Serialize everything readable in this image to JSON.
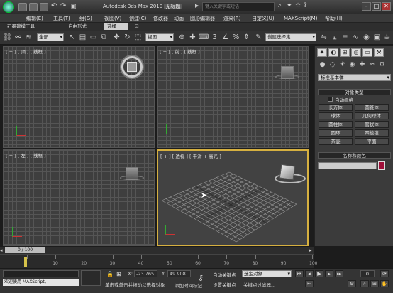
{
  "titlebar": {
    "app_title": "Autodesk 3ds Max 2010",
    "file_name": "无标题",
    "search_placeholder": "键入关键字或短语",
    "min": "–",
    "max": "□",
    "close": "✕"
  },
  "menu": [
    "编辑(E)",
    "工具(T)",
    "组(G)",
    "视图(V)",
    "创建(C)",
    "修改器",
    "动画",
    "图形编辑器",
    "渲染(R)",
    "自定义(U)",
    "MAXScript(M)",
    "帮助(H)"
  ],
  "ribbon_tabs": [
    "石墨建模工具",
    "自由形式",
    "选择"
  ],
  "ribbon_active": "选择",
  "toolbar": {
    "filter_value": "全部",
    "refcoord_value": "视图",
    "named_selection_value": "创建选择集"
  },
  "viewports": {
    "top": "[ + ] [ 顶 ] [ 线框 ]",
    "front": "[ + ] [ 前 ] [ 线框 ]",
    "left": "[ + ] [ 左 ] [ 线框 ]",
    "perspective": "[ + ] [ 透视 ] [ 平滑 + 高光 ]"
  },
  "command_panel": {
    "category_value": "标准基本体",
    "object_type_header": "对象类型",
    "autogrid_label": "自动栅格",
    "object_buttons": [
      "长方体",
      "圆锥体",
      "球体",
      "几何球体",
      "圆柱体",
      "管状体",
      "圆环",
      "四棱锥",
      "茶壶",
      "平面"
    ],
    "name_color_header": "名称和颜色",
    "color_swatch": "#a0103a"
  },
  "timeline": {
    "slider_text": "0 / 100",
    "ticks": [
      "0",
      "10",
      "20",
      "30",
      "40",
      "50",
      "60",
      "70",
      "80",
      "90",
      "100"
    ]
  },
  "status": {
    "maxscript_text": "欢迎使用 MAXScript。",
    "prompt_text": "单击或单击并拖动以选择对象",
    "add_time_tag": "添加时间标记",
    "x_label": "X:",
    "x_value": "-23.765",
    "y_label": "Y:",
    "y_value": "49.908",
    "auto_key": "自动关键点",
    "set_key": "设置关键点",
    "key_filter_value": "选定对象",
    "key_filters_label": "关键点过滤器...",
    "frame_value": "0"
  },
  "colors": {
    "active_viewport_border": "#d6b040",
    "accent": "#d0d0d0"
  }
}
